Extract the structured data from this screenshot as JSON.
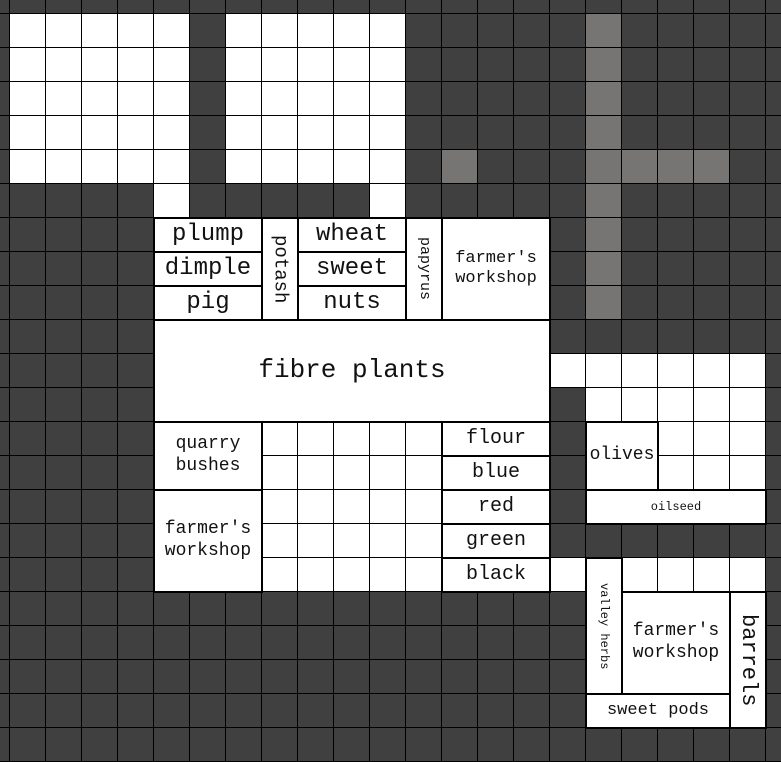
{
  "colors": {
    "empty": "#404040",
    "open": "#ffffff",
    "marked": "#777474",
    "grid_line": "#000000"
  },
  "zones": [
    {
      "id": "plump",
      "label": "plump",
      "size": 24
    },
    {
      "id": "dimple",
      "label": "dimple",
      "size": 24
    },
    {
      "id": "pig",
      "label": "pig",
      "size": 24
    },
    {
      "id": "potash",
      "label": "potash",
      "size": 19,
      "vertical": true
    },
    {
      "id": "wheat",
      "label": "wheat",
      "size": 24
    },
    {
      "id": "sweet",
      "label": "sweet",
      "size": 24
    },
    {
      "id": "nuts",
      "label": "nuts",
      "size": 24
    },
    {
      "id": "papyrus",
      "label": "papyrus",
      "size": 15,
      "vertical": true
    },
    {
      "id": "farmers-workshop-1",
      "label": "farmer's\nworkshop",
      "size": 17
    },
    {
      "id": "fibre-plants",
      "label": "fibre plants",
      "size": 26
    },
    {
      "id": "quarry-bushes",
      "label": "quarry\nbushes",
      "size": 18
    },
    {
      "id": "farmers-workshop-2",
      "label": "farmer's\nworkshop",
      "size": 18
    },
    {
      "id": "flour",
      "label": "flour",
      "size": 20
    },
    {
      "id": "blue",
      "label": "blue",
      "size": 20
    },
    {
      "id": "red",
      "label": "red",
      "size": 20
    },
    {
      "id": "green",
      "label": "green",
      "size": 20
    },
    {
      "id": "black",
      "label": "black",
      "size": 20
    },
    {
      "id": "olives",
      "label": "olives",
      "size": 18
    },
    {
      "id": "oilseed",
      "label": "oilseed",
      "size": 12
    },
    {
      "id": "valley-herbs",
      "label": "valley herbs",
      "size": 12,
      "vertical": true
    },
    {
      "id": "farmers-workshop-3",
      "label": "farmer's\nworkshop",
      "size": 18
    },
    {
      "id": "barrels",
      "label": "barrels",
      "size": 22,
      "vertical": true
    },
    {
      "id": "sweet-pods",
      "label": "sweet pods",
      "size": 17
    }
  ]
}
